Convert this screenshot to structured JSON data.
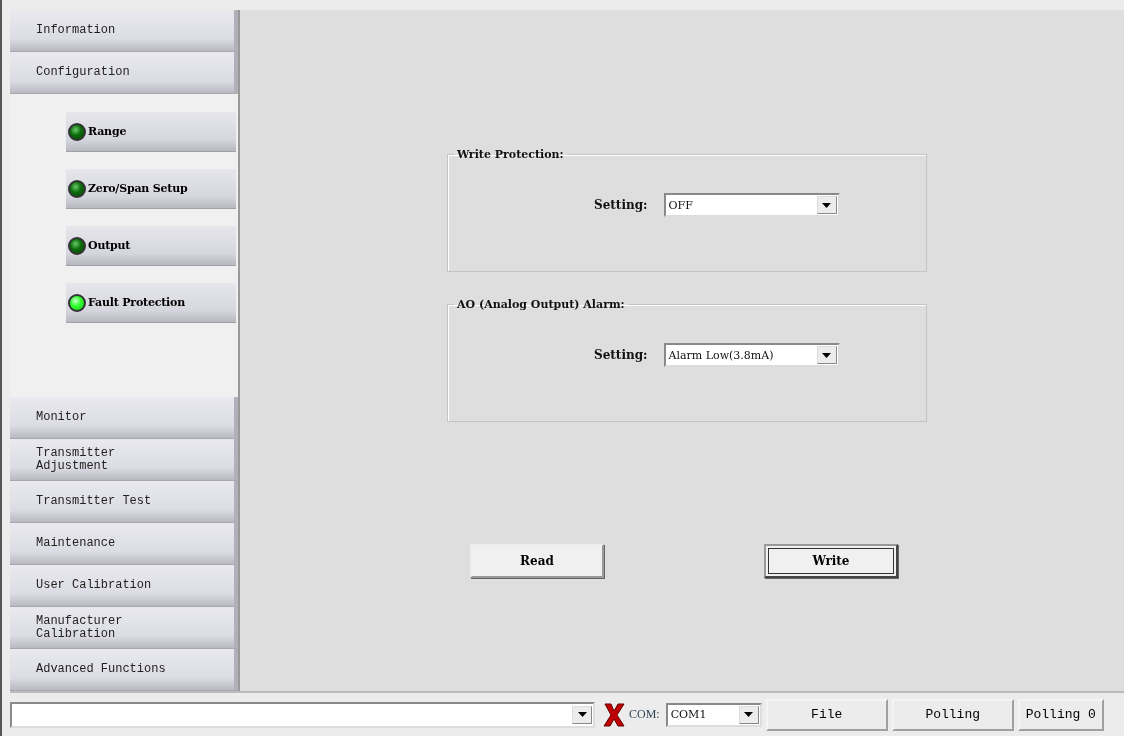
{
  "sidebar": {
    "items": [
      {
        "label": "Information"
      },
      {
        "label": "Configuration",
        "children": [
          {
            "label": "Range",
            "selected": false
          },
          {
            "label": "Zero/Span Setup",
            "selected": false
          },
          {
            "label": "Output",
            "selected": false
          },
          {
            "label": "Fault Protection",
            "selected": true
          }
        ]
      },
      {
        "label": "Monitor"
      },
      {
        "label": "Transmitter Adjustment"
      },
      {
        "label": "Transmitter Test"
      },
      {
        "label": "Maintenance"
      },
      {
        "label": "User Calibration"
      },
      {
        "label": "Manufacturer Calibration"
      },
      {
        "label": "Advanced Functions"
      }
    ]
  },
  "groups": [
    {
      "title": "Write Protection:",
      "setting_label": "Setting:",
      "value": "OFF"
    },
    {
      "title": "AO (Analog Output) Alarm:",
      "setting_label": "Setting:",
      "value": "Alarm Low(3.8mA)"
    }
  ],
  "buttons": [
    {
      "label": "Read",
      "default": false
    },
    {
      "label": "Write",
      "default": true
    }
  ],
  "status_bar": {
    "com_label": "COM:",
    "com_value": "COM1",
    "buttons": [
      "File",
      "Polling",
      "Polling 0"
    ]
  }
}
